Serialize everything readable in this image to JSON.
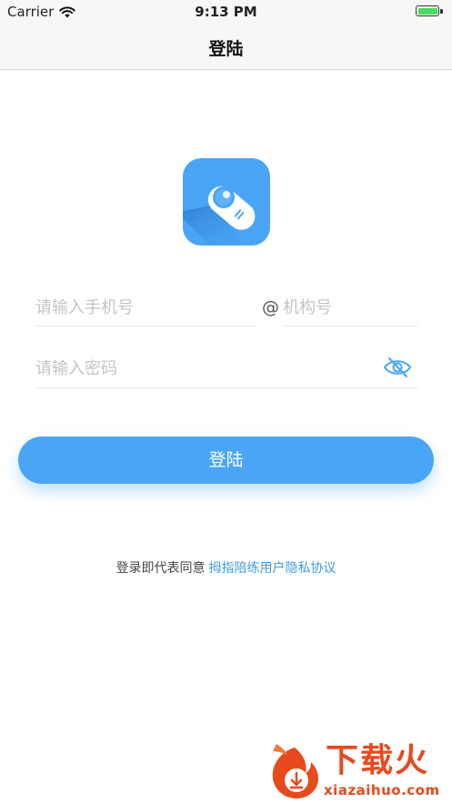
{
  "status_bar": {
    "carrier": "Carrier",
    "time": "9:13 PM",
    "battery_level": 1.0,
    "battery_color": "#4cd964"
  },
  "nav": {
    "title": "登陆"
  },
  "logo": {
    "icon": "app-logo-icon",
    "color": "#4aa5f7"
  },
  "form": {
    "phone_placeholder": "请输入手机号",
    "phone_value": "",
    "at_sign": "@",
    "org_placeholder": "机构号",
    "org_value": "",
    "password_placeholder": "请输入密码",
    "password_value": "",
    "password_toggle_icon": "eye-hidden-icon"
  },
  "login_button": {
    "label": "登陆",
    "color": "#4aa5f7"
  },
  "agreement": {
    "prefix": "登录即代表同意",
    "link": "拇指陪练用户隐私协议",
    "link_color": "#3d9be9"
  },
  "watermark": {
    "main": "下载火",
    "sub": "xiazaihuo.com",
    "color": "#e8491d"
  }
}
